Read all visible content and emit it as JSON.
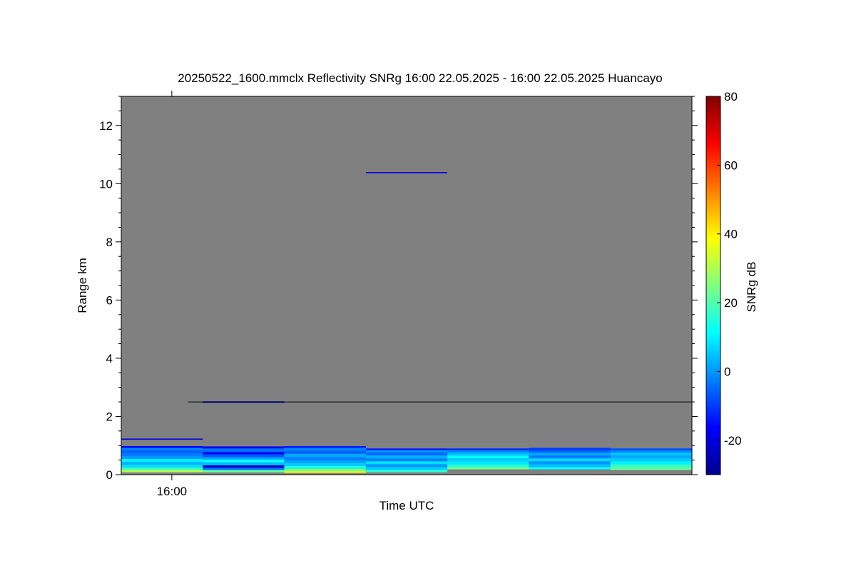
{
  "chart_data": {
    "type": "heatmap",
    "title": "20250522_1600.mmclx Reflectivity SNRg   16:00 22.05.2025 - 16:00 22.05.2025 Huancayo",
    "xlabel": "Time UTC",
    "ylabel": "Range km",
    "x_ticks": [
      "16:00"
    ],
    "ylim": [
      0,
      13
    ],
    "y_ticks": [
      0,
      2,
      4,
      6,
      8,
      10,
      12
    ],
    "background_color": "#808080",
    "colorbar": {
      "label": "SNRg dB",
      "range": [
        -30,
        80
      ],
      "ticks": [
        -20,
        0,
        20,
        40,
        60,
        80
      ]
    },
    "columns": [
      {
        "cells": [
          {
            "y0": 0.08,
            "y1": 0.16,
            "value": 30
          },
          {
            "y0": 0.16,
            "y1": 0.24,
            "value": 18
          },
          {
            "y0": 0.24,
            "y1": 0.34,
            "value": 8
          },
          {
            "y0": 0.34,
            "y1": 0.44,
            "value": 3
          },
          {
            "y0": 0.44,
            "y1": 0.54,
            "value": 10
          },
          {
            "y0": 0.54,
            "y1": 0.64,
            "value": 0
          },
          {
            "y0": 0.64,
            "y1": 0.74,
            "value": -3
          },
          {
            "y0": 0.74,
            "y1": 0.84,
            "value": -6
          },
          {
            "y0": 0.84,
            "y1": 0.92,
            "value": -2
          },
          {
            "y0": 0.92,
            "y1": 0.98,
            "value": -16
          },
          {
            "y0": 1.2,
            "y1": 1.24,
            "value": -20
          }
        ]
      },
      {
        "cells": [
          {
            "y0": 0.08,
            "y1": 0.16,
            "value": 22
          },
          {
            "y0": 0.16,
            "y1": 0.24,
            "value": -4
          },
          {
            "y0": 0.24,
            "y1": 0.32,
            "value": -22
          },
          {
            "y0": 0.32,
            "y1": 0.42,
            "value": 4
          },
          {
            "y0": 0.42,
            "y1": 0.52,
            "value": 12
          },
          {
            "y0": 0.52,
            "y1": 0.6,
            "value": 2
          },
          {
            "y0": 0.6,
            "y1": 0.7,
            "value": -7
          },
          {
            "y0": 0.7,
            "y1": 0.78,
            "value": -16
          },
          {
            "y0": 0.78,
            "y1": 0.9,
            "value": -4
          },
          {
            "y0": 0.9,
            "y1": 0.97,
            "value": -18
          },
          {
            "y0": 2.47,
            "y1": 2.52,
            "value": -22
          }
        ]
      },
      {
        "cells": [
          {
            "y0": 0.06,
            "y1": 0.12,
            "value": 38
          },
          {
            "y0": 0.12,
            "y1": 0.2,
            "value": 24
          },
          {
            "y0": 0.2,
            "y1": 0.3,
            "value": 14
          },
          {
            "y0": 0.3,
            "y1": 0.4,
            "value": 6
          },
          {
            "y0": 0.4,
            "y1": 0.5,
            "value": 1
          },
          {
            "y0": 0.5,
            "y1": 0.6,
            "value": -3
          },
          {
            "y0": 0.6,
            "y1": 0.72,
            "value": 2
          },
          {
            "y0": 0.72,
            "y1": 0.82,
            "value": -6
          },
          {
            "y0": 0.82,
            "y1": 0.92,
            "value": -2
          },
          {
            "y0": 0.92,
            "y1": 0.98,
            "value": -14
          }
        ]
      },
      {
        "cells": [
          {
            "y0": 0.08,
            "y1": 0.16,
            "value": 16
          },
          {
            "y0": 0.16,
            "y1": 0.26,
            "value": 6
          },
          {
            "y0": 0.26,
            "y1": 0.36,
            "value": 0
          },
          {
            "y0": 0.36,
            "y1": 0.46,
            "value": 8
          },
          {
            "y0": 0.46,
            "y1": 0.56,
            "value": -2
          },
          {
            "y0": 0.56,
            "y1": 0.66,
            "value": 3
          },
          {
            "y0": 0.66,
            "y1": 0.76,
            "value": -5
          },
          {
            "y0": 0.76,
            "y1": 0.84,
            "value": 0
          },
          {
            "y0": 0.84,
            "y1": 0.9,
            "value": -14
          },
          {
            "y0": 10.36,
            "y1": 10.4,
            "value": -20
          }
        ]
      },
      {
        "cells": [
          {
            "y0": 0.18,
            "y1": 0.26,
            "value": 24
          },
          {
            "y0": 0.26,
            "y1": 0.36,
            "value": 14
          },
          {
            "y0": 0.36,
            "y1": 0.46,
            "value": 9
          },
          {
            "y0": 0.46,
            "y1": 0.56,
            "value": 6
          },
          {
            "y0": 0.56,
            "y1": 0.66,
            "value": 11
          },
          {
            "y0": 0.66,
            "y1": 0.76,
            "value": 4
          },
          {
            "y0": 0.76,
            "y1": 0.84,
            "value": -2
          },
          {
            "y0": 0.84,
            "y1": 0.9,
            "value": -12
          }
        ]
      },
      {
        "cells": [
          {
            "y0": 0.18,
            "y1": 0.26,
            "value": 12
          },
          {
            "y0": 0.26,
            "y1": 0.36,
            "value": 4
          },
          {
            "y0": 0.36,
            "y1": 0.46,
            "value": 0
          },
          {
            "y0": 0.46,
            "y1": 0.56,
            "value": 7
          },
          {
            "y0": 0.56,
            "y1": 0.66,
            "value": -3
          },
          {
            "y0": 0.66,
            "y1": 0.76,
            "value": 2
          },
          {
            "y0": 0.76,
            "y1": 0.84,
            "value": -6
          },
          {
            "y0": 0.84,
            "y1": 0.92,
            "value": -10
          }
        ]
      },
      {
        "cells": [
          {
            "y0": 0.16,
            "y1": 0.26,
            "value": 22
          },
          {
            "y0": 0.26,
            "y1": 0.36,
            "value": 16
          },
          {
            "y0": 0.36,
            "y1": 0.46,
            "value": 10
          },
          {
            "y0": 0.46,
            "y1": 0.56,
            "value": 6
          },
          {
            "y0": 0.56,
            "y1": 0.66,
            "value": 2
          },
          {
            "y0": 0.66,
            "y1": 0.76,
            "value": 5
          },
          {
            "y0": 0.76,
            "y1": 0.84,
            "value": -2
          },
          {
            "y0": 0.84,
            "y1": 0.9,
            "value": -8
          }
        ]
      }
    ],
    "reference_line_km": 2.5
  }
}
